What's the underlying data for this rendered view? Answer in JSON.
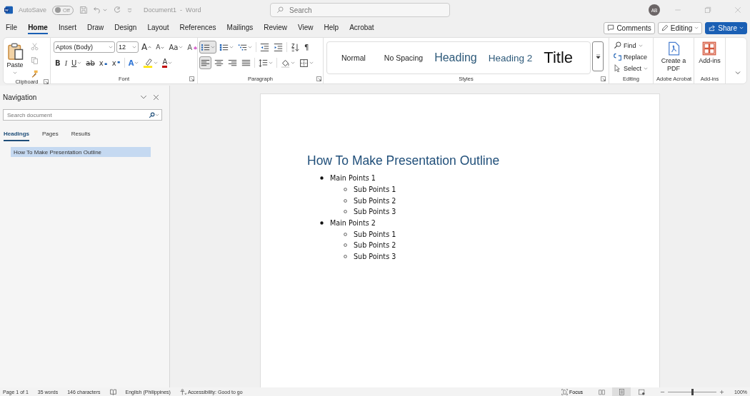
{
  "title_bar": {
    "autosave_label": "AutoSave",
    "autosave": {
      "on": false,
      "label": "Off"
    },
    "document_title": "Document1  -  Word",
    "search_placeholder": "Search",
    "avatar": "AB"
  },
  "menu_tabs": [
    {
      "label": "File",
      "selected": false
    },
    {
      "label": "Home",
      "selected": true
    },
    {
      "label": "Insert",
      "selected": false
    },
    {
      "label": "Draw",
      "selected": false
    },
    {
      "label": "Design",
      "selected": false
    },
    {
      "label": "Layout",
      "selected": false
    },
    {
      "label": "References",
      "selected": false
    },
    {
      "label": "Mailings",
      "selected": false
    },
    {
      "label": "Review",
      "selected": false
    },
    {
      "label": "View",
      "selected": false
    },
    {
      "label": "Help",
      "selected": false
    },
    {
      "label": "Acrobat",
      "selected": false
    }
  ],
  "header_buttons": [
    {
      "kind": "comments",
      "label": "Comments"
    },
    {
      "kind": "editing",
      "label": "Editing"
    },
    {
      "kind": "share",
      "label": "Share"
    }
  ],
  "ribbon": {
    "clipboard": {
      "paste_label": "Paste",
      "label": "Clipboard"
    },
    "font": {
      "font_name": "Aptos (Body)",
      "font_size": "12",
      "label": "Font",
      "row1": [
        {
          "kind": "grow",
          "glyph": "A"
        },
        {
          "kind": "shrink",
          "glyph": "A"
        },
        {
          "kind": "case",
          "glyph": "Aa"
        },
        {
          "kind": "clear",
          "glyph": "A"
        }
      ],
      "row2": [
        {
          "kind": "bold",
          "glyph": "B"
        },
        {
          "kind": "italic",
          "glyph": "I"
        },
        {
          "kind": "underline",
          "glyph": "U"
        },
        {
          "kind": "strike",
          "glyph": "ab"
        },
        {
          "kind": "subscript",
          "glyph": "x"
        },
        {
          "kind": "superscript",
          "glyph": "x"
        },
        {
          "kind": "effects",
          "glyph": "A"
        },
        {
          "kind": "highlight"
        },
        {
          "kind": "color",
          "glyph": "A"
        }
      ]
    },
    "paragraph": {
      "label": "Paragraph",
      "row1": [
        {
          "kind": "bullets",
          "selected": true
        },
        {
          "kind": "numbering",
          "selected": false
        },
        {
          "kind": "multilevel",
          "selected": false
        },
        {
          "kind": "outdent",
          "selected": false
        },
        {
          "kind": "indent",
          "selected": false
        },
        {
          "kind": "sort",
          "selected": false
        },
        {
          "kind": "marks",
          "selected": false,
          "glyph": "¶"
        }
      ],
      "row2": [
        {
          "kind": "align-left",
          "selected": true
        },
        {
          "kind": "center",
          "selected": false
        },
        {
          "kind": "align-right",
          "selected": false
        },
        {
          "kind": "justify",
          "selected": false
        },
        {
          "kind": "spacing",
          "selected": false
        },
        {
          "kind": "shading",
          "selected": false
        },
        {
          "kind": "borders",
          "selected": false
        }
      ]
    },
    "styles": {
      "label": "Styles",
      "items": [
        {
          "kind": "normal",
          "label": "Normal"
        },
        {
          "kind": "nospacing",
          "label": "No Spacing"
        },
        {
          "kind": "heading1",
          "label": "Heading"
        },
        {
          "kind": "heading2",
          "label": "Heading 2"
        },
        {
          "kind": "title",
          "label": "Title"
        }
      ]
    },
    "editing": {
      "label": "Editing",
      "items": [
        {
          "kind": "find",
          "label": "Find"
        },
        {
          "kind": "replace",
          "label": "Replace"
        },
        {
          "kind": "select",
          "label": "Select"
        }
      ]
    },
    "acrobat": {
      "button": "Create a PDF",
      "label": "Adobe Acrobat"
    },
    "addins": {
      "button": "Add-ins",
      "label": "Add-ins"
    }
  },
  "navigation": {
    "title": "Navigation",
    "search_placeholder": "Search document",
    "tabs": [
      {
        "label": "Headings",
        "selected": true
      },
      {
        "label": "Pages",
        "selected": false
      },
      {
        "label": "Results",
        "selected": false
      }
    ],
    "headings": [
      {
        "label": "How To Make Presentation Outline",
        "selected": true
      }
    ]
  },
  "document": {
    "heading": "How To Make Presentation Outline",
    "list": [
      {
        "text": "Main Points 1",
        "children": [
          {
            "text": "Sub Points 1"
          },
          {
            "text": "Sub Points 2"
          },
          {
            "text": "Sub Points 3"
          }
        ]
      },
      {
        "text": "Main Points 2",
        "children": [
          {
            "text": "Sub Points 1"
          },
          {
            "text": "Sub Points 2"
          },
          {
            "text": "Sub Points 3"
          }
        ]
      }
    ]
  },
  "status_bar": {
    "items": [
      {
        "kind": "text",
        "label": "Page 1 of 1"
      },
      {
        "kind": "text",
        "label": "35 words"
      },
      {
        "kind": "text",
        "label": "146 characters"
      },
      {
        "kind": "proofing"
      },
      {
        "kind": "text",
        "label": "English (Philippines)"
      },
      {
        "kind": "accessibility",
        "label": "Accessibility: Good to go"
      }
    ],
    "focus_label": "Focus",
    "views": [
      {
        "kind": "read",
        "selected": false
      },
      {
        "kind": "print",
        "selected": true
      },
      {
        "kind": "web",
        "selected": false
      }
    ],
    "zoom": {
      "level": 0.5,
      "reading": "100%"
    }
  }
}
